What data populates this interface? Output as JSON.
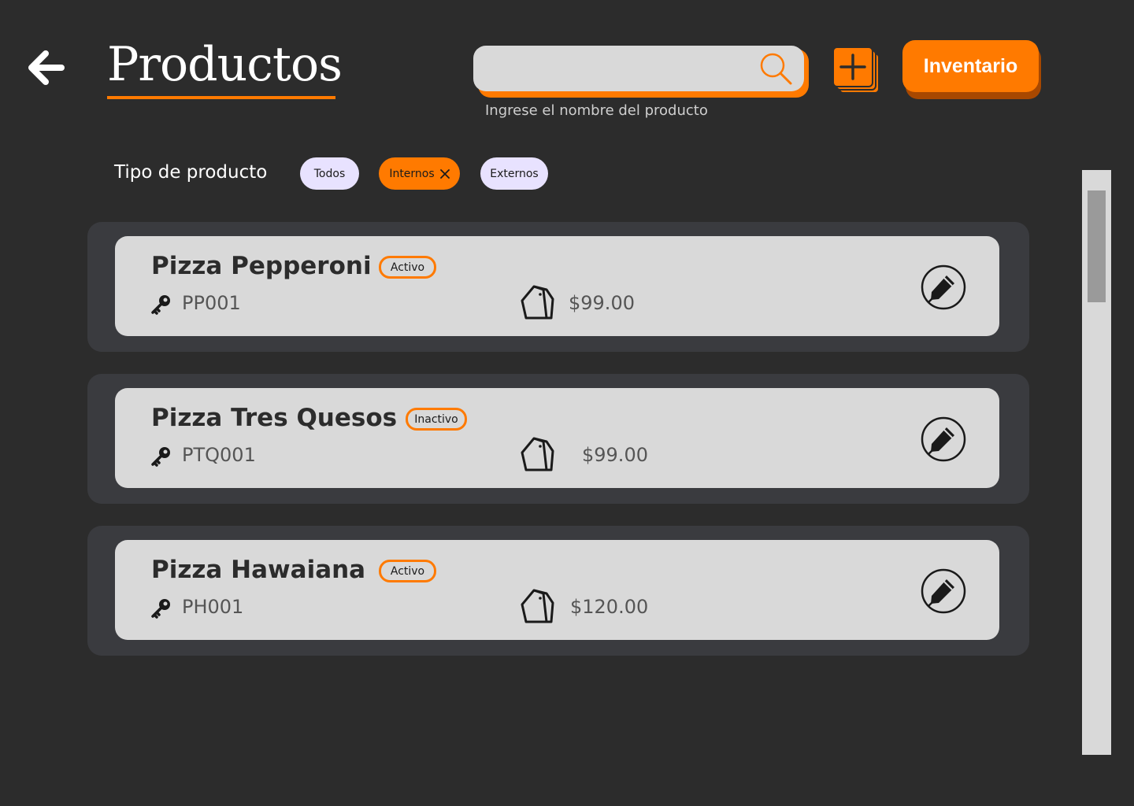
{
  "header": {
    "title": "Productos",
    "search_placeholder": "",
    "search_hint": "Ingrese el nombre del producto",
    "inventory_label": "Inventario"
  },
  "filters": {
    "label": "Tipo de producto",
    "chips": [
      {
        "label": "Todos",
        "selected": false
      },
      {
        "label": "Internos",
        "selected": true
      },
      {
        "label": "Externos",
        "selected": false
      }
    ]
  },
  "products": [
    {
      "name": "Pizza Pepperoni",
      "status": "Activo",
      "code": "PP001",
      "price": "$99.00"
    },
    {
      "name": "Pizza Tres Quesos",
      "status": "Inactivo",
      "code": "PTQ001",
      "price": "$99.00"
    },
    {
      "name": "Pizza Hawaiana",
      "status": "Activo",
      "code": "PH001",
      "price": "$120.00"
    }
  ],
  "colors": {
    "background": "#2c2c2c",
    "accent": "#ff7a00",
    "card_outer": "#3a3b3f",
    "card_inner": "#d9d9d9",
    "chip": "#e8e2ff"
  },
  "icons": [
    "arrow-left-icon",
    "search-icon",
    "add-stack-icon",
    "close-icon",
    "key-icon",
    "price-tag-icon",
    "edit-pencil-icon"
  ]
}
